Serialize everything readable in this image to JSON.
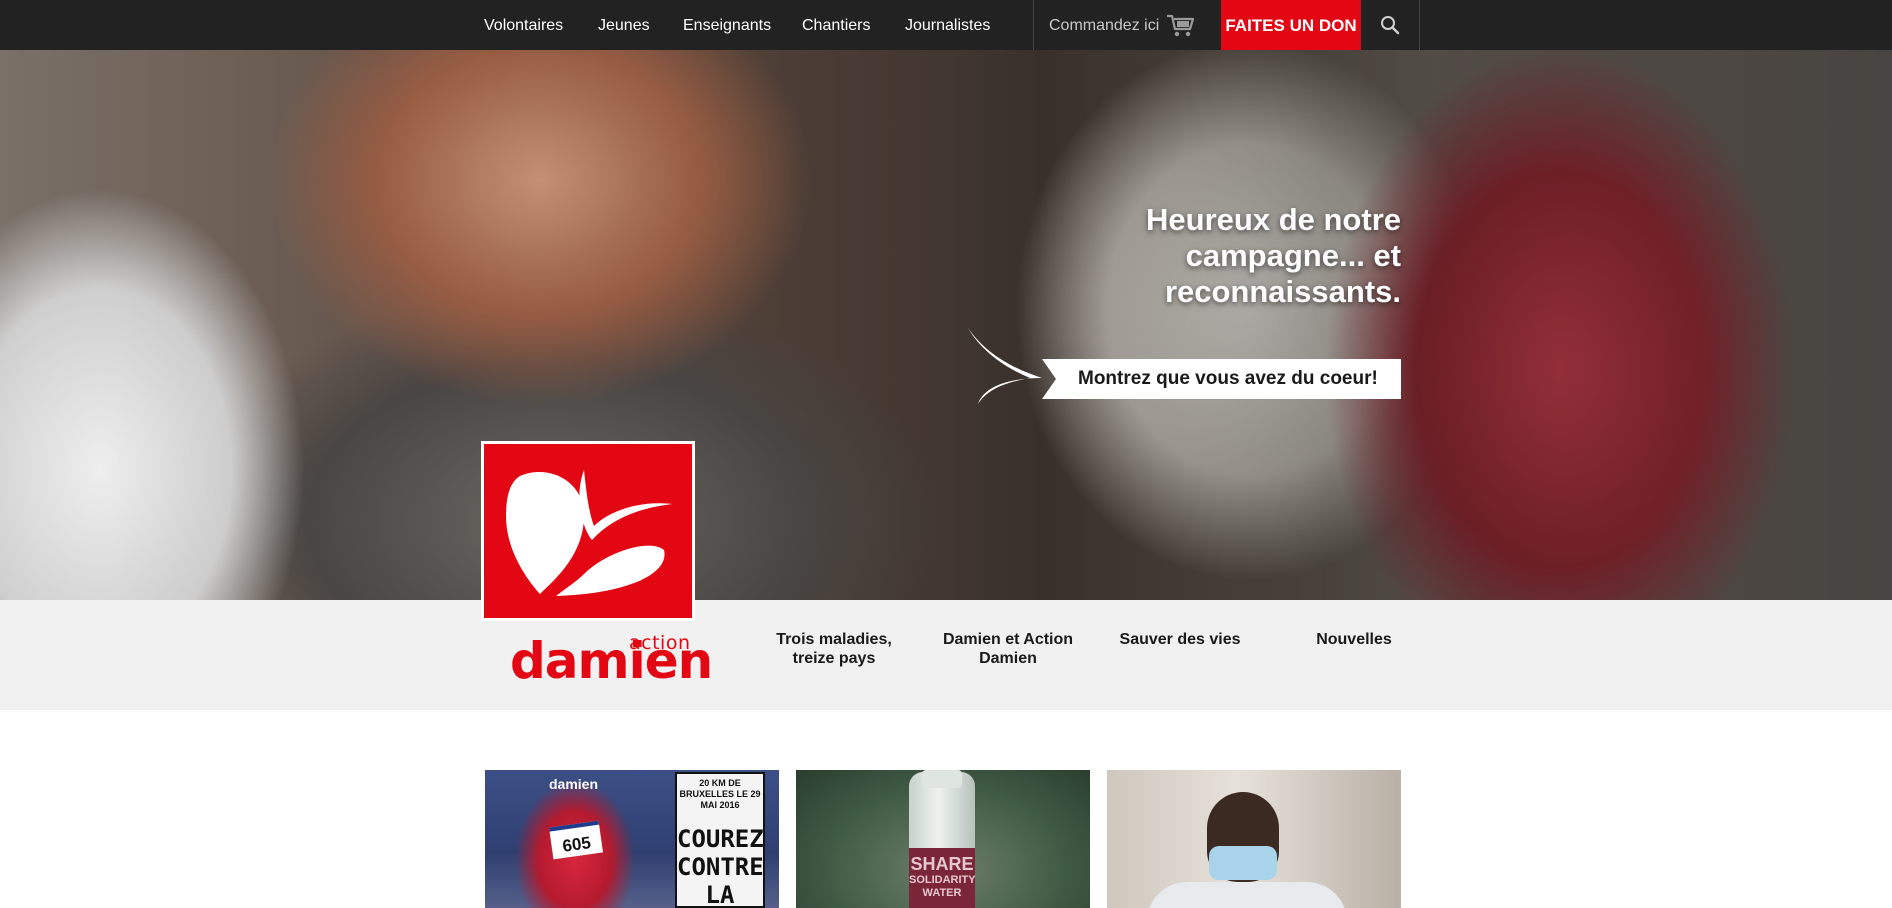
{
  "topnav": {
    "items": [
      "Volontaires",
      "Jeunes",
      "Enseignants",
      "Chantiers",
      "Journalistes"
    ],
    "order_label": "Commandez ici",
    "donate_label": "FAITES UN DON",
    "icons": {
      "cart": "cart-icon",
      "search": "search-icon"
    }
  },
  "hero": {
    "headline": "Heureux de notre\ncampagne... et\nreconnaissants.",
    "cta_label": "Montrez que vous avez du coeur!"
  },
  "brand": {
    "logo_small": "action",
    "logo_big": "damien",
    "color": "#e30613"
  },
  "subnav": {
    "items": [
      "Trois maladies, treize pays",
      "Damien et Action Damien",
      "Sauver des vies",
      "Nouvelles"
    ]
  },
  "cards": {
    "runner": {
      "brand": "damien",
      "bib": "605",
      "poster_top": "20 KM DE BRUXELLES LE 29 MAI 2016",
      "poster_big": "COUREZ CONTRE LA LEPRE"
    },
    "water": {
      "label_share": "SHARE",
      "label_rest": "SOLIDARITY WATER"
    }
  }
}
